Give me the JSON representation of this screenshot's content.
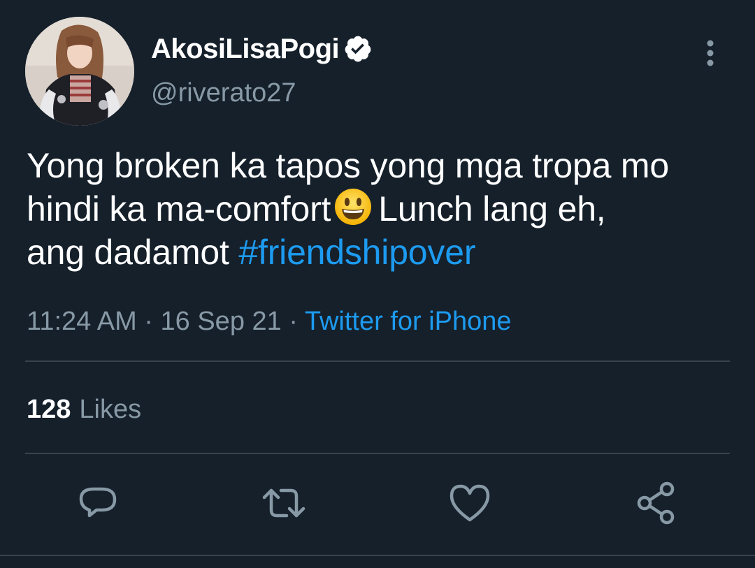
{
  "user": {
    "display_name": "AkosiLisaPogi",
    "handle": "@riverato27",
    "verified": true
  },
  "tweet": {
    "text_line_1": "Yong broken ka tapos yong mga tropa mo",
    "text_line_2a": "hindi ka ma-comfort",
    "emoji": "smiling-face-with-open-mouth",
    "text_line_2b": "Lunch lang eh,",
    "text_line_3": "ang dadamot",
    "hashtag": "#friendshipover",
    "time": "11:24 AM",
    "date": "16 Sep 21",
    "separator": "·",
    "source": "Twitter for iPhone"
  },
  "stats": {
    "likes_count": "128",
    "likes_label": "Likes"
  },
  "icons": {
    "more": "more-vertical-icon",
    "reply": "reply-icon",
    "retweet": "retweet-icon",
    "like": "heart-icon",
    "share": "share-icon"
  },
  "colors": {
    "background": "#15202b",
    "accent": "#1d9bf0",
    "secondary_text": "#8899a6",
    "divider": "#38444d"
  }
}
